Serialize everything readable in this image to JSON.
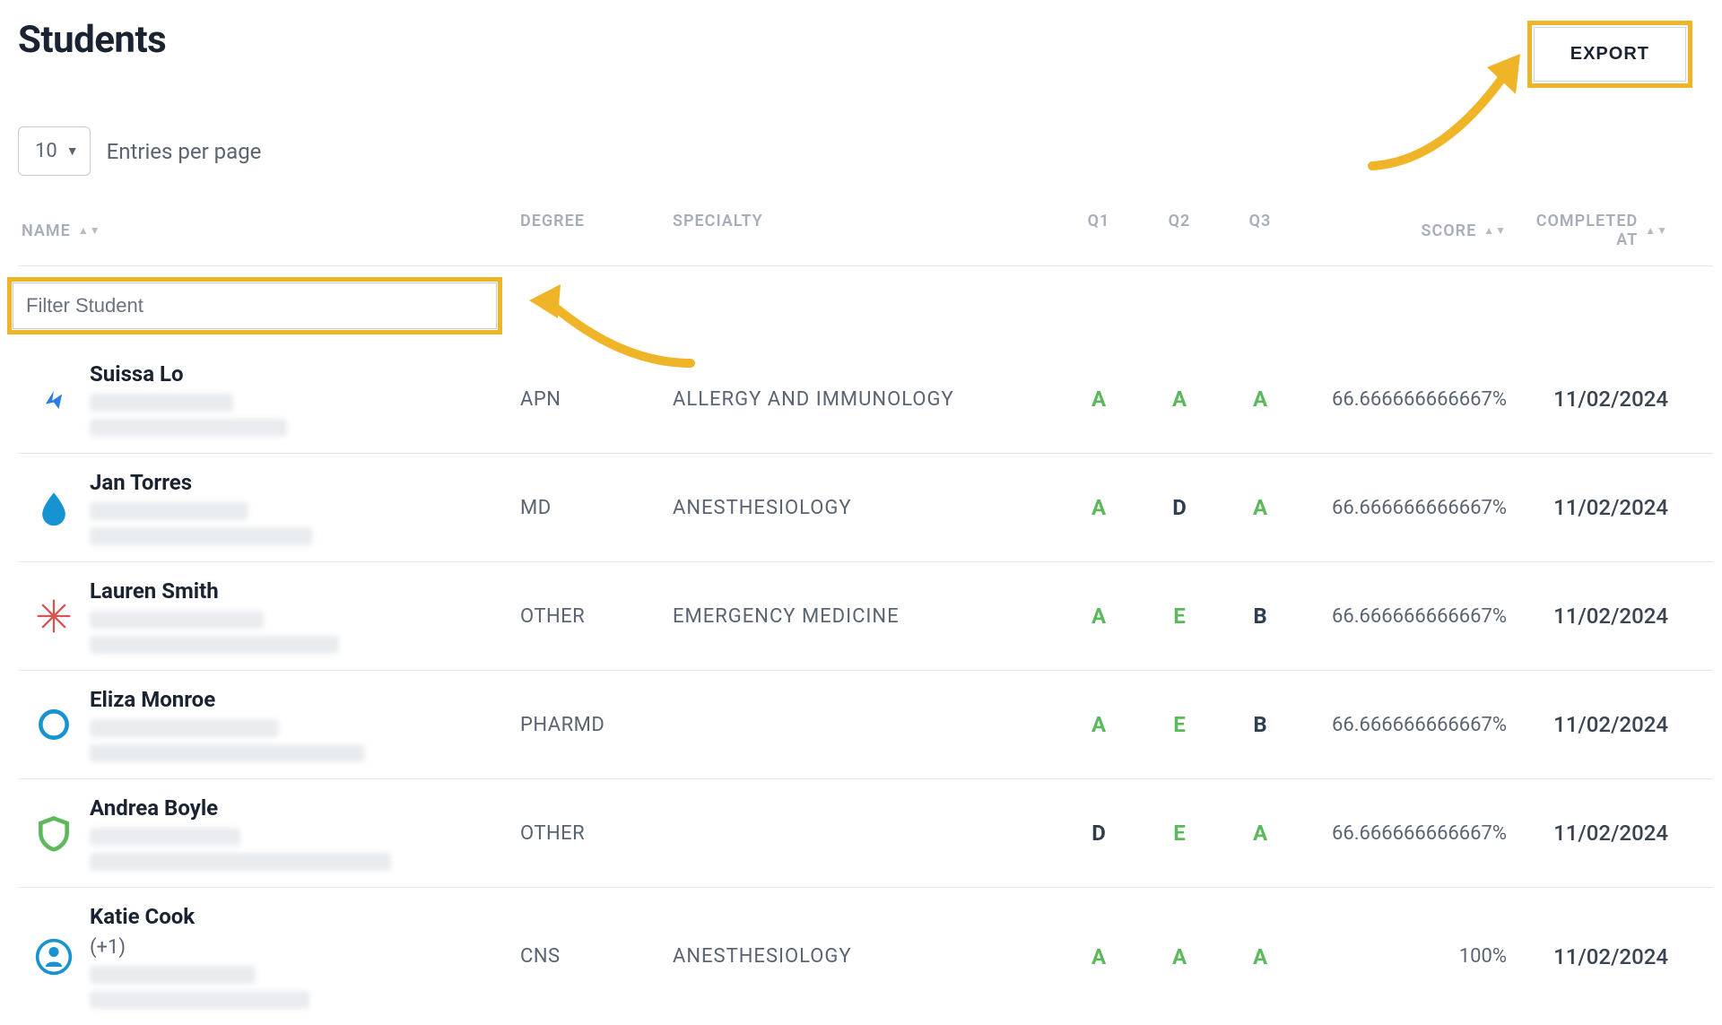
{
  "header": {
    "title": "Students",
    "export_label": "EXPORT"
  },
  "entries": {
    "value": "10",
    "label": "Entries per page"
  },
  "columns": {
    "name": "NAME",
    "degree": "DEGREE",
    "specialty": "SPECIALTY",
    "q1": "Q1",
    "q2": "Q2",
    "q3": "Q3",
    "score": "SCORE",
    "completed": "COMPLETED AT"
  },
  "filter": {
    "placeholder": "Filter Student"
  },
  "rows": [
    {
      "name": "Suissa Lo",
      "subtext": "",
      "degree": "APN",
      "specialty": "ALLERGY AND IMMUNOLOGY",
      "q1": "A",
      "q1c": "green",
      "q2": "A",
      "q2c": "green",
      "q3": "A",
      "q3c": "green",
      "score": "66.666666666667%",
      "date": "11/02/2024",
      "icon": "arrows"
    },
    {
      "name": "Jan Torres",
      "subtext": "",
      "degree": "MD",
      "specialty": "ANESTHESIOLOGY",
      "q1": "A",
      "q1c": "green",
      "q2": "D",
      "q2c": "dark",
      "q3": "A",
      "q3c": "green",
      "score": "66.666666666667%",
      "date": "11/02/2024",
      "icon": "drop"
    },
    {
      "name": "Lauren Smith",
      "subtext": "",
      "degree": "OTHER",
      "specialty": "EMERGENCY MEDICINE",
      "q1": "A",
      "q1c": "green",
      "q2": "E",
      "q2c": "green",
      "q3": "B",
      "q3c": "dark",
      "score": "66.666666666667%",
      "date": "11/02/2024",
      "icon": "burst"
    },
    {
      "name": "Eliza Monroe",
      "subtext": "",
      "degree": "PHARMD",
      "specialty": "",
      "q1": "A",
      "q1c": "green",
      "q2": "E",
      "q2c": "green",
      "q3": "B",
      "q3c": "dark",
      "score": "66.666666666667%",
      "date": "11/02/2024",
      "icon": "ring"
    },
    {
      "name": "Andrea Boyle",
      "subtext": "",
      "degree": "OTHER",
      "specialty": "",
      "q1": "D",
      "q1c": "dark",
      "q2": "E",
      "q2c": "green",
      "q3": "A",
      "q3c": "green",
      "score": "66.666666666667%",
      "date": "11/02/2024",
      "icon": "shield"
    },
    {
      "name": "Katie Cook",
      "subtext": "(+1)",
      "degree": "CNS",
      "specialty": "ANESTHESIOLOGY",
      "q1": "A",
      "q1c": "green",
      "q2": "A",
      "q2c": "green",
      "q3": "A",
      "q3c": "green",
      "score": "100%",
      "date": "11/02/2024",
      "icon": "person"
    }
  ]
}
